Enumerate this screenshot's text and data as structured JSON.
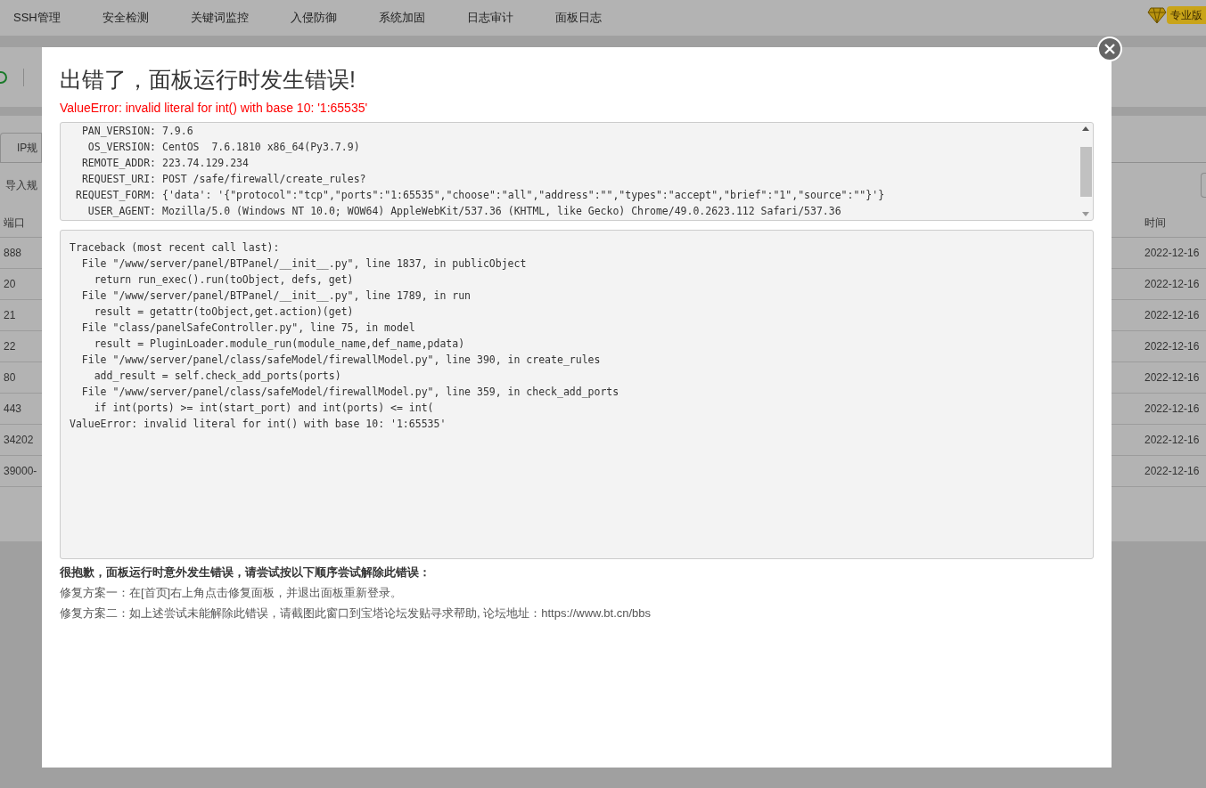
{
  "nav": {
    "items": [
      {
        "label": "SSH管理"
      },
      {
        "label": "安全检测"
      },
      {
        "label": "关键词监控"
      },
      {
        "label": "入侵防御"
      },
      {
        "label": "系统加固"
      },
      {
        "label": "日志审计"
      },
      {
        "label": "面板日志"
      }
    ],
    "badge": "专业版"
  },
  "background": {
    "tab": "IP规",
    "import_button": "导入规",
    "port_column": "端口",
    "ports": [
      "888",
      "20",
      "21",
      "22",
      "80",
      "443",
      "34202",
      "39000-"
    ],
    "time_column": "时间",
    "times": [
      "2022-12-16",
      "2022-12-16",
      "2022-12-16",
      "2022-12-16",
      "2022-12-16",
      "2022-12-16",
      "2022-12-16",
      "2022-12-16"
    ]
  },
  "dialog": {
    "title": "出错了，面板运行时发生错误!",
    "error": "ValueError: invalid literal for int() with base 10: '1:65535'",
    "info": [
      {
        "key": "PAN_VERSION:",
        "value": "7.9.6"
      },
      {
        "key": "OS_VERSION:",
        "value": "CentOS  7.6.1810 x86_64(Py3.7.9)"
      },
      {
        "key": "REMOTE_ADDR:",
        "value": "223.74.129.234"
      },
      {
        "key": "REQUEST_URI:",
        "value": "POST /safe/firewall/create_rules?"
      },
      {
        "key": "REQUEST_FORM:",
        "value": "{'data': '{\"protocol\":\"tcp\",\"ports\":\"1:65535\",\"choose\":\"all\",\"address\":\"\",\"types\":\"accept\",\"brief\":\"1\",\"source\":\"\"}'}"
      },
      {
        "key": "USER_AGENT:",
        "value": "Mozilla/5.0 (Windows NT 10.0; WOW64) AppleWebKit/537.36 (KHTML, like Gecko) Chrome/49.0.2623.112 Safari/537.36"
      }
    ],
    "traceback": [
      "Traceback (most recent call last):",
      "  File \"/www/server/panel/BTPanel/__init__.py\", line 1837, in publicObject",
      "    return run_exec().run(toObject, defs, get)",
      "  File \"/www/server/panel/BTPanel/__init__.py\", line 1789, in run",
      "    result = getattr(toObject,get.action)(get)",
      "  File \"class/panelSafeController.py\", line 75, in model",
      "    result = PluginLoader.module_run(module_name,def_name,pdata)",
      "  File \"/www/server/panel/class/safeModel/firewallModel.py\", line 390, in create_rules",
      "    add_result = self.check_add_ports(ports)",
      "  File \"/www/server/panel/class/safeModel/firewallModel.py\", line 359, in check_add_ports",
      "    if int(ports) >= int(start_port) and int(ports) <= int(",
      "ValueError: invalid literal for int() with base 10: '1:65535'"
    ],
    "help_title": "很抱歉，面板运行时意外发生错误，请尝试按以下顺序尝试解除此错误：",
    "help_lines": [
      "修复方案一：在[首页]右上角点击修复面板，并退出面板重新登录。",
      "修复方案二：如上述尝试未能解除此错误，请截图此窗口到宝塔论坛发贴寻求帮助, 论坛地址：https://www.bt.cn/bbs"
    ]
  }
}
